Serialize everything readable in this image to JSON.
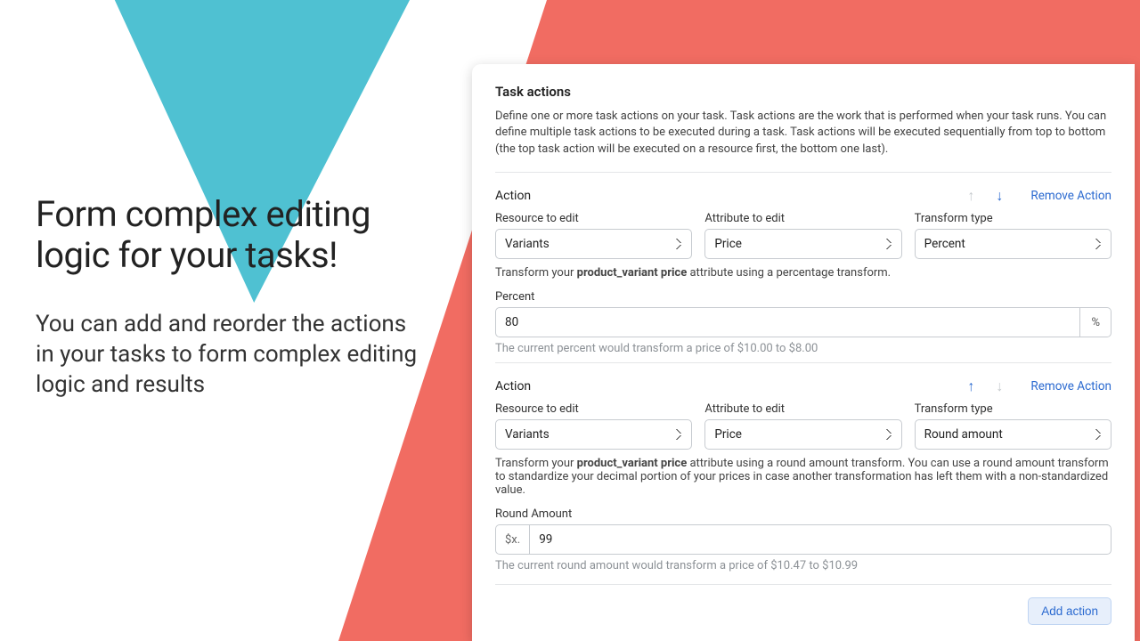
{
  "marketing": {
    "headline": "Form complex editing logic for your tasks!",
    "sub": "You can add and reorder the actions in your tasks to form complex editing logic and results"
  },
  "panel": {
    "title": "Task actions",
    "description": "Define one or more task actions on your task. Task actions are the work that is performed when your task runs. You can define multiple task actions to be executed during a task. Task actions will be executed sequentially from top to bottom (the top task action will be executed on a resource first, the bottom one last).",
    "add_button": "Add action"
  },
  "labels": {
    "action": "Action",
    "resource": "Resource to edit",
    "attribute": "Attribute to edit",
    "transform": "Transform type",
    "remove": "Remove Action",
    "percent": "Percent",
    "round_amount": "Round Amount"
  },
  "action1": {
    "resource_value": "Variants",
    "attribute_value": "Price",
    "transform_value": "Percent",
    "helper_pre": "Transform your ",
    "helper_bold": "product_variant price",
    "helper_post": " attribute using a percentage transform.",
    "percent_value": "80",
    "percent_suffix": "%",
    "result": "The current percent would transform a price of $10.00 to $8.00"
  },
  "action2": {
    "resource_value": "Variants",
    "attribute_value": "Price",
    "transform_value": "Round amount",
    "helper_pre": "Transform your ",
    "helper_bold": "product_variant price",
    "helper_post": " attribute using a round amount transform. You can use a round amount transform to standardize your decimal portion of your prices in case another transformation has left them with a non-standardized value.",
    "round_prefix": "$x.",
    "round_value": "99",
    "result": "The current round amount would transform a price of $10.47 to $10.99"
  }
}
